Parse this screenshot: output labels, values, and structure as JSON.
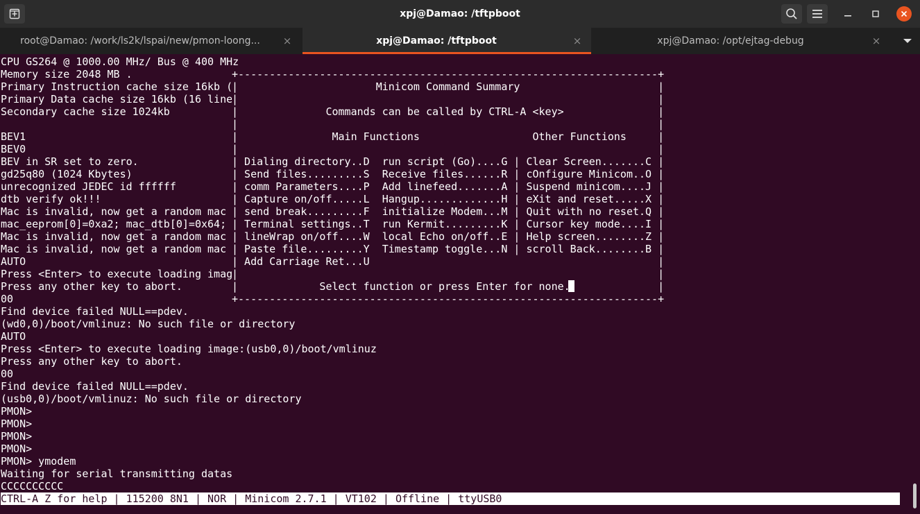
{
  "window": {
    "title": "xpj@Damao: /tftpboot",
    "icons": [
      "new-tab-icon",
      "search-icon",
      "hamburger-menu-icon",
      "minimize-icon",
      "maximize-icon",
      "close-icon"
    ],
    "accent_color": "#e95420",
    "terminal_bg": "#300a24"
  },
  "tabs": [
    {
      "label": "root@Damao: /work/ls2k/lspai/new/pmon-loong...",
      "close": "×",
      "active": false
    },
    {
      "label": "xpj@Damao: /tftpboot",
      "close": "×",
      "active": true
    },
    {
      "label": "xpj@Damao: /opt/ejtag-debug",
      "close": "×",
      "active": false
    }
  ],
  "terminal": {
    "lines": [
      "CPU GS264 @ 1000.00 MHz/ Bus @ 400 MHz",
      "Memory size 2048 MB .",
      "Primary Instruction cache size 16kb (",
      "Primary Data cache size 16kb (16 line",
      "Secondary cache size 1024kb",
      "",
      "BEV1",
      "BEV0",
      "BEV in SR set to zero.",
      "gd25q80 (1024 Kbytes)",
      "unrecognized JEDEC id ffffff",
      "dtb verify ok!!!",
      "Mac is invalid, now get a random mac",
      "mac_eeprom[0]=0xa2; mac_dtb[0]=0x64;",
      "Mac is invalid, now get a random mac",
      "Mac is invalid, now get a random mac",
      "AUTO",
      "Press <Enter> to execute loading imag",
      "Press any other key to abort.",
      "00",
      "Find device failed NULL==pdev.",
      "(wd0,0)/boot/vmlinuz: No such file or directory",
      "AUTO",
      "Press <Enter> to execute loading image:(usb0,0)/boot/vmlinuz",
      "Press any other key to abort.",
      "00",
      "Find device failed NULL==pdev.",
      "(usb0,0)/boot/vmlinuz: No such file or directory",
      "PMON>",
      "PMON>",
      "PMON>",
      "PMON>",
      "PMON> ymodem",
      "Waiting for serial transmitting datas",
      "CCCCCCCCCC"
    ]
  },
  "minicom_popup": {
    "lines": [
      "+-------------------------------------------------------------------+",
      "|                      Minicom Command Summary                      |",
      "|                                                                   |",
      "|              Commands can be called by CTRL-A <key>               |",
      "|                                                                   |",
      "|               Main Functions                  Other Functions     |",
      "|                                                                   |",
      "| Dialing directory..D  run script (Go)....G | Clear Screen.......C |",
      "| Send files.........S  Receive files......R | cOnfigure Minicom..O |",
      "| comm Parameters....P  Add linefeed.......A | Suspend minicom....J |",
      "| Capture on/off.....L  Hangup.............H | eXit and reset.....X |",
      "| send break.........F  initialize Modem...M | Quit with no reset.Q |",
      "| Terminal settings..T  run Kermit.........K | Cursor key mode....I |",
      "| lineWrap on/off....W  local Echo on/off..E | Help screen........Z |",
      "| Paste file.........Y  Timestamp toggle...N | scroll Back........B |",
      "| Add Carriage Ret...U                                              |",
      "|                                                                   |",
      "|             Select function or press Enter for none.              |",
      "+-------------------------------------------------------------------+"
    ]
  },
  "status_bar": {
    "text": "CTRL-A Z for help | 115200 8N1 | NOR | Minicom 2.7.1 | VT102 | Offline | ttyUSB0"
  }
}
